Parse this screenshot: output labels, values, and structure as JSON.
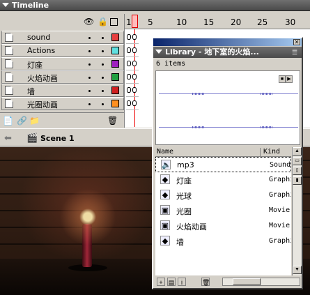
{
  "timeline": {
    "title": "Timeline",
    "frame_numbers": [
      "1",
      "5",
      "10",
      "15",
      "20",
      "25",
      "30"
    ],
    "layers": [
      {
        "name": "sound",
        "color": "#e84040"
      },
      {
        "name": "Actions",
        "color": "#60e0e0"
      },
      {
        "name": "灯座",
        "color": "#a020c0"
      },
      {
        "name": "火焰动画",
        "color": "#20a040"
      },
      {
        "name": "墙",
        "color": "#d02020"
      },
      {
        "name": "光圈动画",
        "color": "#ff9020"
      }
    ]
  },
  "scene": {
    "name": "Scene 1"
  },
  "library": {
    "title": "Library - 地下室的火焰...",
    "count": "6 items",
    "columns": {
      "name": "Name",
      "kind": "Kind"
    },
    "items": [
      {
        "name": "mp3",
        "kind": "Sound",
        "icon": "sound-icon",
        "glyph": "🔈"
      },
      {
        "name": "灯座",
        "kind": "Graphic",
        "icon": "graphic-icon",
        "glyph": "◆"
      },
      {
        "name": "光球",
        "kind": "Graphic",
        "icon": "graphic-icon",
        "glyph": "◆"
      },
      {
        "name": "光圈",
        "kind": "Movie",
        "icon": "movie-clip-icon",
        "glyph": "▣"
      },
      {
        "name": "火焰动画",
        "kind": "Movie",
        "icon": "movie-clip-icon",
        "glyph": "▣"
      },
      {
        "name": "墙",
        "kind": "Graphic",
        "icon": "graphic-icon",
        "glyph": "◆"
      }
    ]
  }
}
